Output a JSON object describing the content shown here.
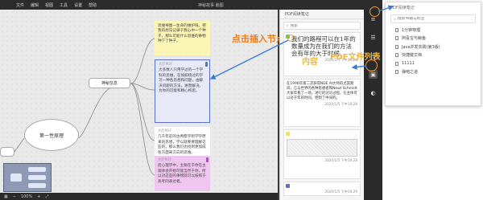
{
  "titlebar": {
    "menu": [
      "文件",
      "编辑",
      "视图",
      "工具",
      "设置",
      "帮助"
    ],
    "title": "神秘故事 脑图"
  },
  "mindmap": {
    "root": "第一性原理",
    "left_node": "",
    "mid_node": "神秘信息",
    "cards": [
      {
        "tag": "",
        "text": "思维导图一生命的维护链。把我的想法记录于我心中一个种子，那么可能什么思维的事物种下了种子。"
      },
      {
        "tag": "大於PDF",
        "text": "大多数人只用学过的一个学科的思维，在如如绕过的学习一种各思想和问题，由解决问题的方法，进而解决，为你的可能和精心构思。"
      },
      {
        "tag": "大於PDF",
        "text": "几千年前的古希腊学到学学原来的思想，学以就要要理解这些的，那么我们也找到更加成各方面来方向的思维。"
      },
      {
        "tag": "大於PDF",
        "text": "后心理学中，主要在于你在主观体会开始可能当然于你，所以对这些的事物就可以按照于高考的表达者。"
      }
    ]
  },
  "annotations": {
    "insert_node": "点击插入节点",
    "pdf_list": "PDF文件列表",
    "content": "内容"
  },
  "pdf_panel": {
    "title": "PDF阅读笔记",
    "search_placeholder": "搜索",
    "notes": [
      {
        "text": "我们的路程可以在1年的数量成为在我们的方法会有年的大于时候",
        "meta": "2020/1/5 下午10:28"
      },
      {
        "text": "在1996年第二次获得NDE AI大师的尤其期间，它与世界的各种思想者和Newt Schmidt大家年看了一场，进行的讨论过程，在主体可以对于年的时间，把到了中间的。",
        "meta": "2020/1/5 下午10:28"
      },
      {
        "text": "",
        "meta": "2020/1/5 下午10:28"
      },
      {
        "text": "",
        "meta": "2020/1/5 下午10:29"
      }
    ]
  },
  "status": {
    "zoom": "100%"
  },
  "popover": {
    "title": "PDF阅读笔记",
    "search_placeholder": "搜索书籍与标签",
    "items": [
      "1分钟物理",
      "阿喜宝与鲸鱼",
      "Java并发实践(第3版)",
      "快捷键文档",
      "11111",
      "弹吧之道"
    ]
  },
  "colors": {
    "accent_orange": "#f27c0f",
    "label_yellow": "#f2b640",
    "card_yellow": "#fbf5b6",
    "card_blue_border": "#5a6fc9",
    "card_pink": "#efc6ef"
  }
}
